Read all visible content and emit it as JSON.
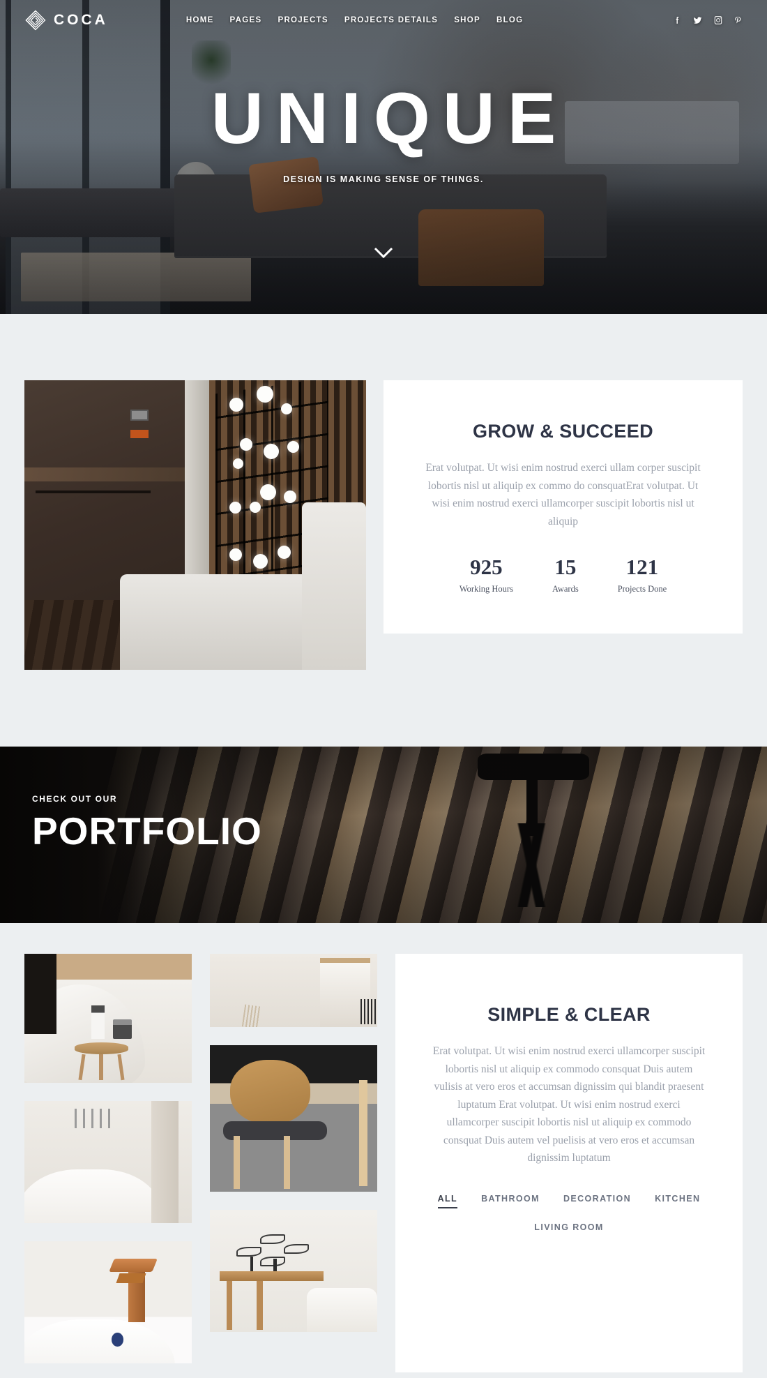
{
  "header": {
    "brand": "COCA",
    "logo_icon": "coca-spiral-logo-icon",
    "nav": [
      {
        "label": "HOME"
      },
      {
        "label": "PAGES"
      },
      {
        "label": "PROJECTS"
      },
      {
        "label": "PROJECTS DETAILS"
      },
      {
        "label": "SHOP"
      },
      {
        "label": "BLOG"
      }
    ],
    "socials": [
      {
        "name": "facebook-icon",
        "label": "Facebook"
      },
      {
        "name": "twitter-icon",
        "label": "Twitter"
      },
      {
        "name": "instagram-icon",
        "label": "Instagram"
      },
      {
        "name": "pinterest-icon",
        "label": "Pinterest"
      }
    ]
  },
  "hero": {
    "title": "UNIQUE",
    "subtitle": "DESIGN IS MAKING SENSE OF THINGS.",
    "scroll_icon": "chevron-down-icon"
  },
  "grow": {
    "title": "GROW & SUCCEED",
    "paragraph": "Erat volutpat. Ut wisi enim nostrud exerci ullam corper suscipit lobortis nisl ut aliquip ex commo do consquatErat volutpat. Ut wisi enim nostrud exerci ullamcorper suscipit lobortis nisl ut aliquip",
    "stats": [
      {
        "value": "925",
        "label": "Working Hours"
      },
      {
        "value": "15",
        "label": "Awards"
      },
      {
        "value": "121",
        "label": "Projects Done"
      }
    ]
  },
  "portfolio_band": {
    "kicker": "CHECK OUT OUR",
    "title": "PORTFOLIO"
  },
  "portfolio": {
    "title": "SIMPLE & CLEAR",
    "paragraph": "Erat volutpat. Ut wisi enim nostrud exerci ullamcorper suscipit lobortis nisl ut aliquip ex commodo consquat Duis autem vulisis at vero eros et accumsan dignissim qui blandit praesent luptatum Erat volutpat. Ut wisi enim nostrud exerci ullamcorper suscipit lobortis nisl ut aliquip ex commodo consquat Duis autem vel puelisis at vero eros et accumsan dignissim luptatum",
    "filters": [
      {
        "label": "ALL",
        "active": true
      },
      {
        "label": "BATHROOM",
        "active": false
      },
      {
        "label": "DECORATION",
        "active": false
      },
      {
        "label": "KITCHEN",
        "active": false
      },
      {
        "label": "LIVING ROOM",
        "active": false
      }
    ],
    "tiles": [
      {
        "alt": "Bathtub with wooden stool and toiletries"
      },
      {
        "alt": "Minimal white room with doorway"
      },
      {
        "alt": "Wooden chair with grey seat in kitchen"
      },
      {
        "alt": "White freestanding bathtub"
      },
      {
        "alt": "Copper waterfall basin faucet"
      },
      {
        "alt": "Console table with fish sculptures"
      }
    ]
  },
  "colors": {
    "page_bg": "#eceff1",
    "card_bg": "#ffffff",
    "heading": "#2e3446",
    "body_text": "#9aa0ab",
    "dark_band": "#0c0a09",
    "accent_white": "#ffffff"
  }
}
